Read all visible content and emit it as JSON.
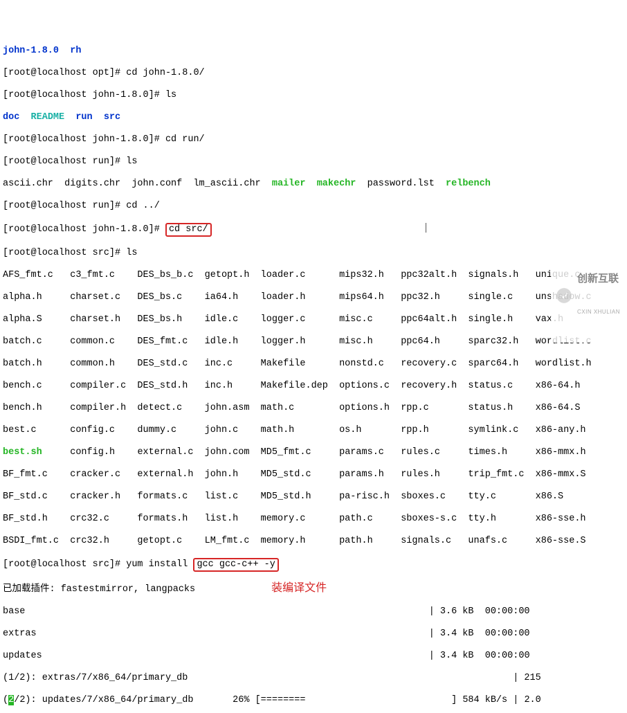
{
  "line01": {
    "a": "john-1.8.0",
    "b": "  ",
    "c": "rh"
  },
  "line02": {
    "prompt": "[root@localhost opt]# ",
    "cmd": "cd john-1.8.0/"
  },
  "line03": {
    "prompt": "[root@localhost john-1.8.0]# ",
    "cmd": "ls"
  },
  "line04": {
    "a": "doc",
    "sp1": "  ",
    "b": "README",
    "sp2": "  ",
    "c": "run",
    "sp3": "  ",
    "d": "src"
  },
  "line05": {
    "prompt": "[root@localhost john-1.8.0]# ",
    "cmd": "cd run/"
  },
  "line06": {
    "prompt": "[root@localhost run]# ",
    "cmd": "ls"
  },
  "line07": {
    "a": "ascii.chr  digits.chr  john.conf  lm_ascii.chr  ",
    "b": "mailer",
    "sp1": "  ",
    "c": "makechr",
    "sp2": "  ",
    "d": "password.lst  ",
    "e": "relbench"
  },
  "line08": {
    "prompt": "[root@localhost run]# ",
    "cmd": "cd ../"
  },
  "line09": {
    "prompt": "[root@localhost john-1.8.0]# ",
    "box": "cd src/",
    "tail": "                                      "
  },
  "line10": {
    "prompt": "[root@localhost src]# ",
    "cmd": "ls"
  },
  "ls_rows": [
    "AFS_fmt.c   c3_fmt.c    DES_bs_b.c  getopt.h  loader.c      mips32.h   ppc32alt.h  signals.h   unique.c",
    "alpha.h     charset.c   DES_bs.c    ia64.h    loader.h      mips64.h   ppc32.h     single.c    unshadow.c",
    "alpha.S     charset.h   DES_bs.h    idle.c    logger.c      misc.c     ppc64alt.h  single.h    vax.h",
    "batch.c     common.c    DES_fmt.c   idle.h    logger.h      misc.h     ppc64.h     sparc32.h   wordlist.c",
    "batch.h     common.h    DES_std.c   inc.c     Makefile      nonstd.c   recovery.c  sparc64.h   wordlist.h",
    "bench.c     compiler.c  DES_std.h   inc.h     Makefile.dep  options.c  recovery.h  status.c    x86-64.h",
    "bench.h     compiler.h  detect.c    john.asm  math.c        options.h  rpp.c       status.h    x86-64.S",
    "best.c      config.c    dummy.c     john.c    math.h        os.h       rpp.h       symlink.c   x86-any.h"
  ],
  "ls_best": {
    "a": "best.sh",
    "sp": "     ",
    "rest": "config.h    external.c  john.com  MD5_fmt.c     params.c   rules.c     times.h     x86-mmx.h"
  },
  "ls_rows2": [
    "BF_fmt.c    cracker.c   external.h  john.h    MD5_std.c     params.h   rules.h     trip_fmt.c  x86-mmx.S",
    "BF_std.c    cracker.h   formats.c   list.c    MD5_std.h     pa-risc.h  sboxes.c    tty.c       x86.S",
    "BF_std.h    crc32.c     formats.h   list.h    memory.c      path.c     sboxes-s.c  tty.h       x86-sse.h",
    "BSDI_fmt.c  crc32.h     getopt.c    LM_fmt.c  memory.h      path.h     signals.c   unafs.c     x86-sse.S"
  ],
  "yum": {
    "prompt": "[root@localhost src]# ",
    "before": "yum install ",
    "box": "gcc gcc-c++ -y"
  },
  "plugins": "已加载插件: fastestmirror, langpacks",
  "note": "装编译文件",
  "repo": [
    {
      "name": "base",
      "pad": "                                                                        ",
      "size": "| 3.6 kB  00:00:00"
    },
    {
      "name": "extras",
      "pad": "                                                                      ",
      "size": "| 3.4 kB  00:00:00"
    },
    {
      "name": "updates",
      "pad": "                                                                     ",
      "size": "| 3.4 kB  00:00:00"
    }
  ],
  "dl1": {
    "a": "(1/2): extras/7/x86_64/primary_db",
    "pad": "                                                          ",
    "size": "| 215"
  },
  "dl2": {
    "a": "(",
    "b": "2",
    "c": "/2): updates/7/x86_64/primary_db       26% [========                          ] 584 kB/s | 2.0"
  },
  "watermark": {
    "cn": "创新互联",
    "py": "CXIN XHULIAN"
  }
}
